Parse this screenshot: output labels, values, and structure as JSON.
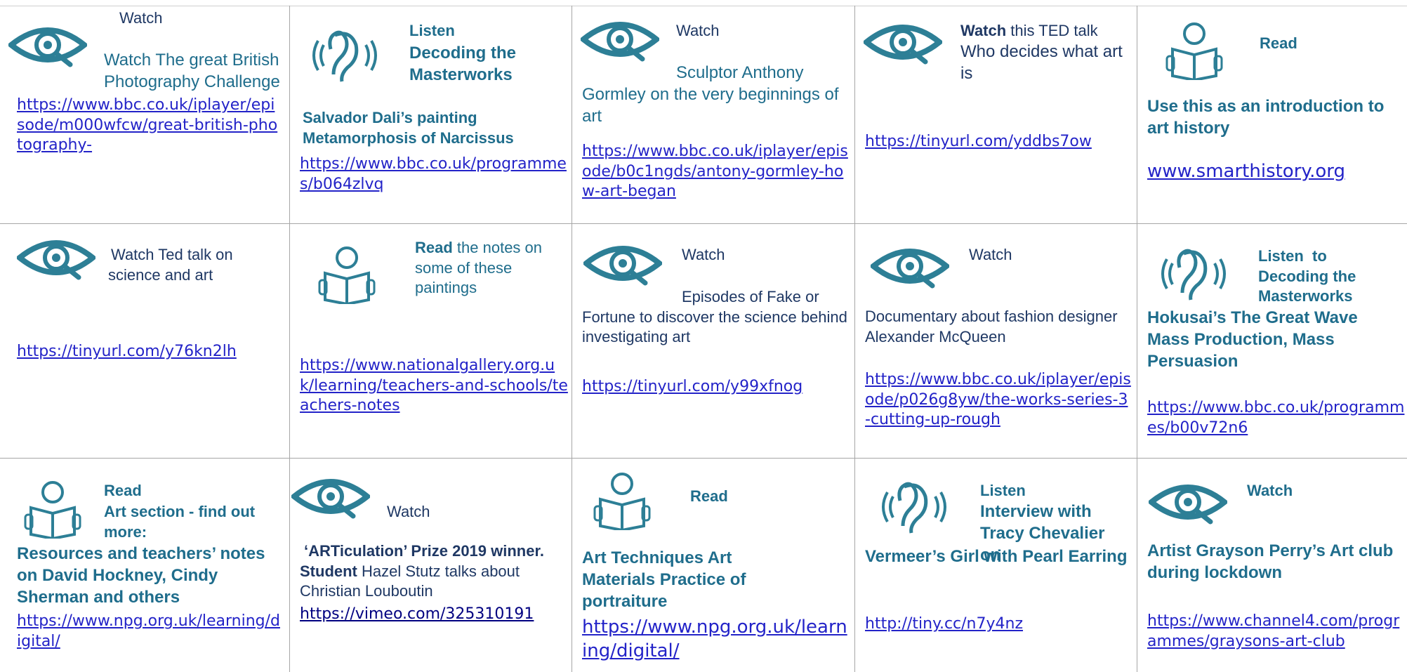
{
  "cells": [
    {
      "type": "Watch",
      "title": "Watch The great British Photography Challenge",
      "url": "https://www.bbc.co.uk/iplayer/episode/m000wfcw/great-british-photography-"
    },
    {
      "type": "Listen",
      "title": "Decoding the Masterworks",
      "desc": "Salvador Dali’s painting Metamorphosis of Narcissus",
      "url": "https://www.bbc.co.uk/programmes/b064zlvq"
    },
    {
      "type": "Watch",
      "desc": "Sculptor Anthony Gormley on the very beginnings of art",
      "url": "https://www.bbc.co.uk/iplayer/episode/b0c1ngds/antony-gormley-how-art-began"
    },
    {
      "type": "Watch",
      "type_suffix": " this TED talk",
      "title": "Who decides what art is",
      "url": "https://tinyurl.com/yddbs7ow"
    },
    {
      "type": "Read",
      "desc": "Use this as an introduction to art history",
      "url": "www.smarthistory.org"
    },
    {
      "title": "Watch Ted talk on science and art",
      "url": "https://tinyurl.com/y76kn2lh"
    },
    {
      "type": "Read",
      "type_suffix": " the notes on some of these paintings",
      "url": "https://www.nationalgallery.org.uk/learning/teachers-and-schools/teachers-notes"
    },
    {
      "type": "Watch",
      "desc": "Episodes of Fake or Fortune to discover the science behind investigating art",
      "url": "https://tinyurl.com/y99xfnog"
    },
    {
      "type": "Watch",
      "desc": "Documentary about fashion designer Alexander McQueen",
      "url": "https://www.bbc.co.uk/iplayer/episode/p026g8yw/the-works-series-3-cutting-up-rough"
    },
    {
      "type": "Listen  to Decoding the Masterworks",
      "desc": "Hokusai’s The Great Wave Mass Production, Mass Persuasion",
      "url": "https://www.bbc.co.uk/programmes/b00v72n6"
    },
    {
      "type": "Read",
      "title": "Art section - find out more:",
      "desc": "Resources and teachers’ notes on David Hockney, Cindy Sherman and others",
      "url": "https://www.npg.org.uk/learning/digital/"
    },
    {
      "type": "Watch",
      "desc_a": "‘ARTiculation’ Prize 2019 winner. Student",
      "desc_b": " Hazel Stutz talks about Christian Louboutin",
      "url": "https://vimeo.com/325310191"
    },
    {
      "type": "Read",
      "desc": "Art Techniques Art Materials Practice of portraiture",
      "url": "https://www.npg.org.uk/learning/digital/"
    },
    {
      "type": "Listen",
      "title": "Interview with Tracy Chevalier on",
      "desc": "Vermeer’s Girl with Pearl Earring",
      "url": "http://tiny.cc/n7y4nz"
    },
    {
      "type": "Watch",
      "desc": "Artist Grayson Perry’s Art club during lockdown",
      "url": "https://www.channel4.com/programmes/graysons-art-club"
    }
  ]
}
